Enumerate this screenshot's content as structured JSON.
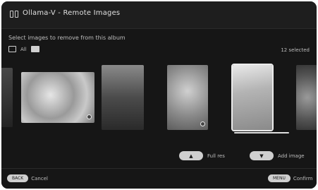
{
  "window": {
    "title": "Ollama-V - Remote Images"
  },
  "header": {
    "status": "Select images to remove from this album",
    "select_all_label": "All",
    "count_label": "12 selected"
  },
  "thumbnails": [
    {
      "name": "thumb-1",
      "tone": "#3a3a3a",
      "selected": false
    },
    {
      "name": "thumb-2",
      "tone": "#bdbdbd",
      "selected": false
    },
    {
      "name": "thumb-3",
      "tone": "#5a5a5a",
      "selected": false
    },
    {
      "name": "thumb-4",
      "tone": "#9c9c9c",
      "selected": false
    },
    {
      "name": "thumb-5",
      "tone": "#a8a8a8",
      "selected": true
    },
    {
      "name": "thumb-6",
      "tone": "#6a6a6a",
      "selected": false
    }
  ],
  "actions": {
    "fullscreen_button": "▲",
    "fullscreen_label": "Full res",
    "add_button": "▼",
    "add_label": "Add image"
  },
  "bottom": {
    "cancel_key": "BACK",
    "cancel_label": "Cancel",
    "confirm_key": "MENU",
    "confirm_label": "Confirm"
  }
}
